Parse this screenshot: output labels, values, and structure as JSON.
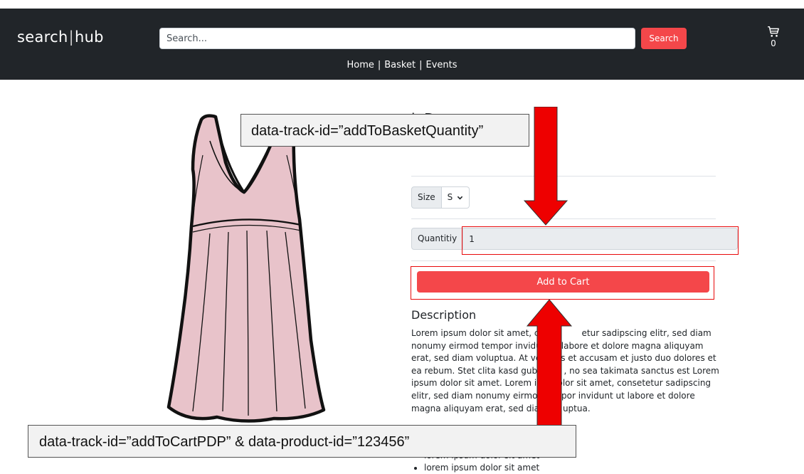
{
  "header": {
    "logo_left": "search",
    "logo_sep": "|",
    "logo_right": "hub",
    "search_placeholder": "Search...",
    "search_button": "Search",
    "cart_icon": "cart-icon",
    "cart_count": "0",
    "nav": [
      "Home",
      "Basket",
      "Events"
    ],
    "nav_separator": "|"
  },
  "product": {
    "title": "k Dress",
    "image_icon": "dress-image",
    "size_label": "Size",
    "size_value": "S",
    "quantity_label": "Quantitiy",
    "quantity_value": "1",
    "add_to_cart": "Add to Cart",
    "description_heading": "Description",
    "description_lines": [
      "Lorem ipsum dolor sit amet, c",
      "nonumy eirmod tempor invidu",
      "erat, sed diam voluptua. At ve",
      "ea rebum. Stet clita kasd gube",
      "ipsum dolor sit amet. Lorem ip",
      "elitr, sed diam nonumy eirmod",
      "magna aliquyam erat, sed diar"
    ],
    "description_line_ends": [
      "etur sadipscing elitr, sed diam",
      "labore et dolore magna aliquyam",
      "s et accusam et justo duo dolores et",
      ", no sea takimata sanctus est Lorem",
      "dolor sit amet, consetetur sadipscing",
      "por invidunt ut labore et dolore",
      "uptua."
    ],
    "bullets": [
      "lorem ipsum dolor sit amet",
      "lorem ipsum dolor sit amet"
    ]
  },
  "annotations": {
    "quantity_callout": "data-track-id=”addToBasketQuantity”",
    "cart_callout": "data-track-id=”addToCartPDP” & data-product-id=”123456”",
    "highlight_color": "#e8090b",
    "arrow_color": "#ee0000"
  }
}
